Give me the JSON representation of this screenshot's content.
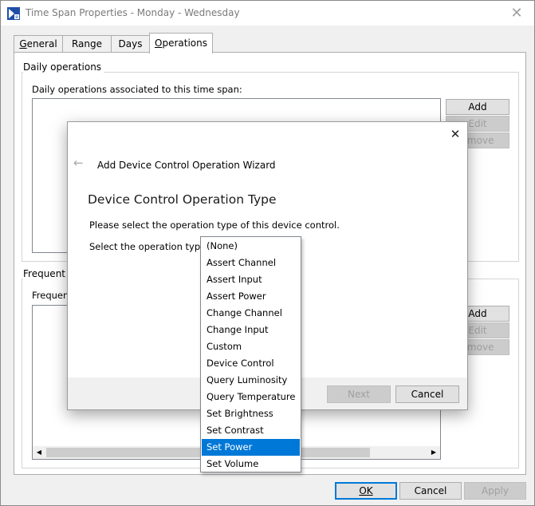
{
  "window": {
    "title": "Time Span Properties - Monday - Wednesday",
    "close_glyph": "✕"
  },
  "tabs": [
    {
      "label": "General",
      "accel": "G",
      "rest": "eneral",
      "active": false
    },
    {
      "label": "Range",
      "accel": "",
      "rest": "Range",
      "active": false
    },
    {
      "label": "Days",
      "accel": "",
      "rest": "Days",
      "active": false
    },
    {
      "label": "Operations",
      "accel": "O",
      "rest": "perations",
      "active": true
    }
  ],
  "daily": {
    "group_label": "Daily operations",
    "list_label": "Daily operations associated to this time span:",
    "buttons": {
      "add": "Add",
      "edit": "Edit",
      "remove": "emove"
    }
  },
  "frequent": {
    "group_label": "Frequent o",
    "list_label": "Frequent",
    "buttons": {
      "add": "Add",
      "edit": "Edit",
      "remove": "emove"
    }
  },
  "footer": {
    "ok": "OK",
    "cancel": "Cancel",
    "apply": "Apply"
  },
  "dialog": {
    "back_glyph": "←",
    "close_glyph": "✕",
    "title": "Add Device Control Operation Wizard",
    "heading": "Device Control Operation Type",
    "instruction": "Please select the operation type of this device control.",
    "select_label": "Select the operation type:",
    "next": "Next",
    "cancel": "Cancel"
  },
  "dropdown": {
    "options": [
      "(None)",
      "Assert Channel",
      "Assert Input",
      "Assert Power",
      "Change Channel",
      "Change Input",
      "Custom",
      "Device Control",
      "Query Luminosity",
      "Query Temperature",
      "Set Brightness",
      "Set Contrast",
      "Set Power",
      "Set Volume"
    ],
    "highlighted": "Set Power"
  },
  "colors": {
    "accent": "#0078d7",
    "window_bg": "#f0f0f0",
    "disabled_text": "#a0a0a0"
  }
}
